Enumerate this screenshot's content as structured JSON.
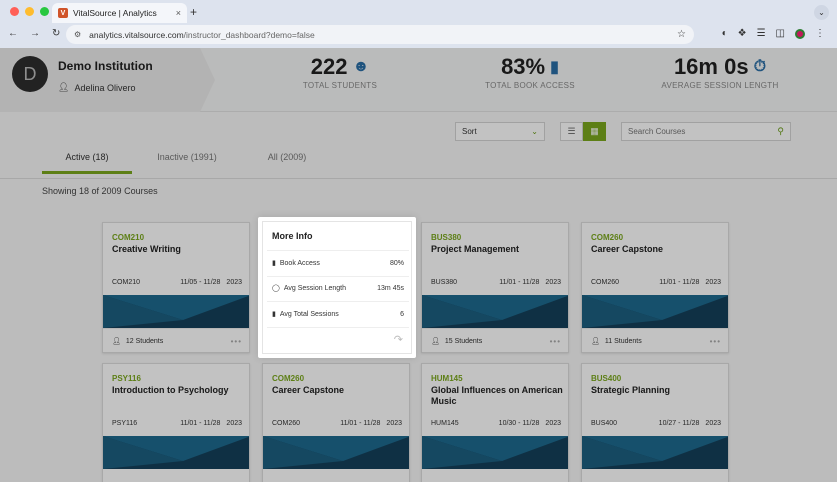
{
  "browser": {
    "tab_title": "VitalSource | Analytics",
    "tab_favicon": "V",
    "tab_close": "×",
    "new_tab": "+",
    "menu_chevron": "⌄",
    "url_host": "analytics.vitalsource.com",
    "url_path": "/instructor_dashboard?demo=false",
    "traffic_colors": [
      "#ff5f57",
      "#febc2e",
      "#28c840"
    ]
  },
  "institution": {
    "avatar_letter": "D",
    "name": "Demo Institution",
    "user": "Adelina Olivero"
  },
  "stats": [
    {
      "value": "222",
      "label": "TOTAL STUDENTS",
      "icon": "person-icon"
    },
    {
      "value": "83%",
      "label": "TOTAL BOOK ACCESS",
      "icon": "book-icon"
    },
    {
      "value": "16m 0s",
      "label": "AVERAGE SESSION LENGTH",
      "icon": "stopwatch-icon"
    }
  ],
  "controls": {
    "sort_label": "Sort",
    "search_placeholder": "Search Courses"
  },
  "tabs": [
    {
      "label": "Active (18)",
      "active": true
    },
    {
      "label": "Inactive (1991)",
      "active": false
    },
    {
      "label": "All (2009)",
      "active": false
    }
  ],
  "showing": "Showing 18 of 2009 Courses",
  "colors": {
    "accent": "#7ba81e",
    "band_dark": "#14405a",
    "band_mid": "#1e6a8f"
  },
  "cards": [
    {
      "code": "COM210",
      "title": "Creative Writing",
      "meta_code": "COM210",
      "dates": "11/05 - 11/28",
      "year": "2023",
      "students": "12 Students"
    },
    {
      "code": "BUS380",
      "title": "Project Management",
      "meta_code": "BUS380",
      "dates": "11/01 - 11/28",
      "year": "2023",
      "students": "15 Students"
    },
    {
      "code": "COM260",
      "title": "Career Capstone",
      "meta_code": "COM260",
      "dates": "11/01 - 11/28",
      "year": "2023",
      "students": "11 Students"
    },
    {
      "code": "PSY116",
      "title": "Introduction to Psychology",
      "meta_code": "PSY116",
      "dates": "11/01 - 11/28",
      "year": "2023"
    },
    {
      "code": "COM260",
      "title": "Career Capstone",
      "meta_code": "COM260",
      "dates": "11/01 - 11/28",
      "year": "2023"
    },
    {
      "code": "HUM145",
      "title": "Global Influences on American Music",
      "meta_code": "HUM145",
      "dates": "10/30 - 11/28",
      "year": "2023"
    },
    {
      "code": "BUS400",
      "title": "Strategic Planning",
      "meta_code": "BUS400",
      "dates": "10/27 - 11/28",
      "year": "2023"
    }
  ],
  "popup": {
    "title": "More Info",
    "rows": [
      {
        "label": "Book Access",
        "value": "80%",
        "icon": "book-icon"
      },
      {
        "label": "Avg Session Length",
        "value": "13m 45s",
        "icon": "stopwatch-icon"
      },
      {
        "label": "Avg Total Sessions",
        "value": "6",
        "icon": "book-icon"
      }
    ]
  }
}
